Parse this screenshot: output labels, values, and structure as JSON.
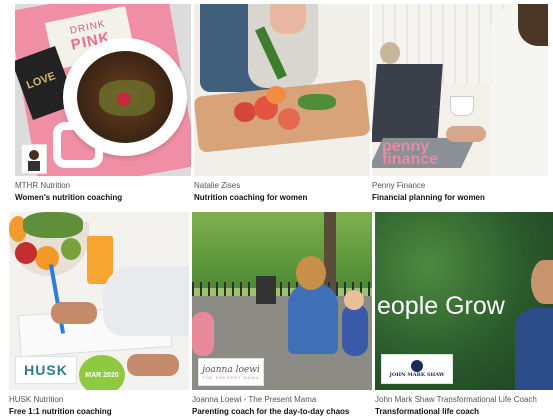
{
  "cards": [
    {
      "author": "MTHR Nutrition",
      "title": "Women's nutrition coaching",
      "mug_text_1": "DRINK",
      "mug_text_2": "PINK",
      "love_text": "LOVE"
    },
    {
      "author": "Natalie Zises",
      "title": "Nutrition coaching for women"
    },
    {
      "author": "Penny Finance",
      "title": "Financial planning for women",
      "brand_1": "penny",
      "brand_2": "finance"
    },
    {
      "author": "HUSK Nutrition",
      "title": "Free 1:1 nutrition coaching",
      "logo": "HUSK",
      "badge": "MAR 2020"
    },
    {
      "author": "Joanna Loewi - The Present Mama",
      "title": "Parenting coach for the day-to-day chaos",
      "logo_1": "joanna loewi",
      "logo_2": "THE PRESENT MAMA"
    },
    {
      "author": "John Mark Shaw Transformational Life Coach",
      "title": "Transformational life coach",
      "headline": "eople Grow",
      "logo": "JOHN MARK SHAW"
    }
  ],
  "colors": {
    "pink": "#ef8ea5",
    "green": "#8fc940",
    "navy": "#1c2a5a",
    "teal": "#2f7b8a"
  }
}
